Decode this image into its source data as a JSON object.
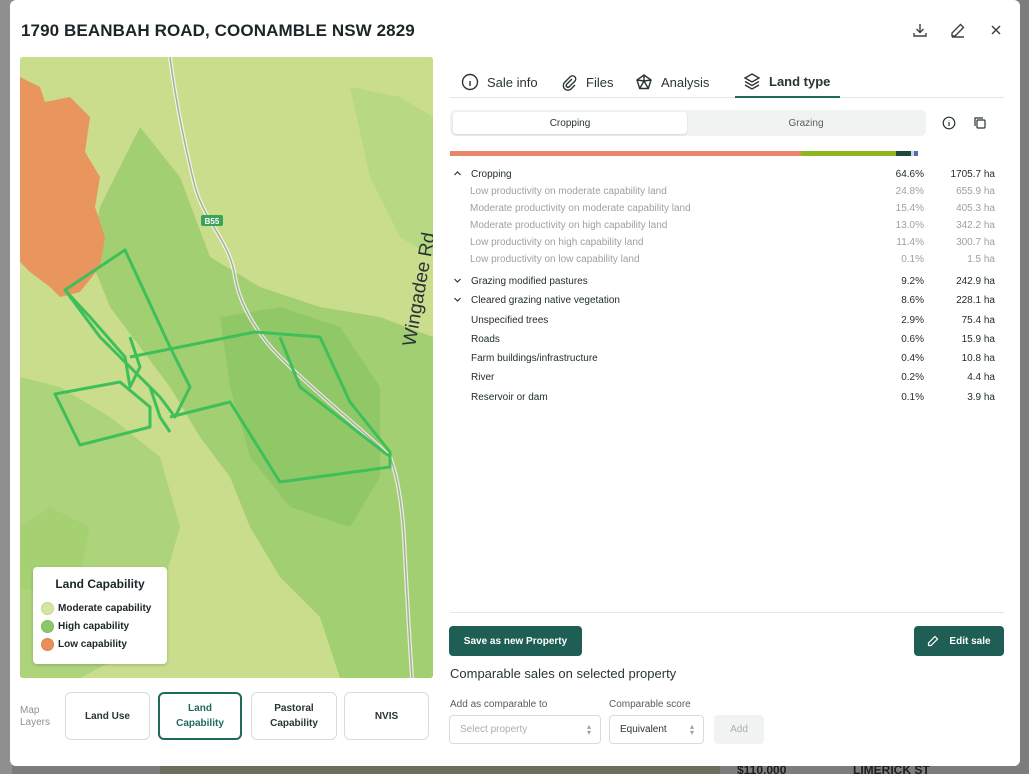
{
  "background": {
    "price": "$110,000",
    "street": "LIMERICK ST"
  },
  "modal": {
    "title": "1790 BEANBAH ROAD, COONAMBLE NSW 2829",
    "icons": [
      "download-icon",
      "edit-icon",
      "close-icon"
    ]
  },
  "map": {
    "road_shield": "B55",
    "road_name": "Wingadee Rd",
    "legend": {
      "title": "Land Capability",
      "items": [
        {
          "label": "Moderate capability",
          "color": "#d6e6a0"
        },
        {
          "label": "High capability",
          "color": "#8cc86a"
        },
        {
          "label": "Low capability",
          "color": "#e88f5a"
        }
      ]
    },
    "layers_label_1": "Map",
    "layers_label_2": "Layers",
    "layer_buttons": [
      {
        "line1": "Land Use",
        "line2": "",
        "active": false
      },
      {
        "line1": "Land",
        "line2": "Capability",
        "active": true
      },
      {
        "line1": "Pastoral",
        "line2": "Capability",
        "active": false
      },
      {
        "line1": "NVIS",
        "line2": "",
        "active": false
      }
    ]
  },
  "tabs": [
    {
      "label": "Sale info",
      "icon": "info-icon"
    },
    {
      "label": "Files",
      "icon": "paperclip-icon"
    },
    {
      "label": "Analysis",
      "icon": "pentagon-icon"
    },
    {
      "label": "Land type",
      "icon": "layers-icon",
      "active": true
    }
  ],
  "segment": {
    "options": [
      "Cropping",
      "Grazing"
    ],
    "selected": "Cropping"
  },
  "bar": [
    {
      "fraction": 0.746,
      "color": "#e8866a"
    },
    {
      "fraction": 0.203,
      "color": "#8fb61e"
    },
    {
      "fraction": 0.032,
      "color": "#1c4a3c"
    },
    {
      "fraction": 0.006,
      "color": "#c7d5e8"
    },
    {
      "fraction": 0.008,
      "color": "#5b6ab0"
    }
  ],
  "land_rows": [
    {
      "type": "main",
      "chev": "^",
      "label": "Cropping",
      "pct": "64.6%",
      "ha": "1705.7 ha"
    },
    {
      "type": "sub",
      "label": "Low productivity on moderate capability land",
      "pct": "24.8%",
      "ha": "655.9 ha"
    },
    {
      "type": "sub",
      "label": "Moderate productivity on moderate capability land",
      "pct": "15.4%",
      "ha": "405.3 ha"
    },
    {
      "type": "sub",
      "label": "Moderate productivity on high capability land",
      "pct": "13.0%",
      "ha": "342.2 ha"
    },
    {
      "type": "sub",
      "label": "Low productivity on high capability land",
      "pct": "11.4%",
      "ha": "300.7 ha"
    },
    {
      "type": "sub",
      "label": "Low productivity on low capability land",
      "pct": "0.1%",
      "ha": "1.5 ha"
    },
    {
      "type": "main",
      "chev": "v",
      "label": "Grazing modified pastures",
      "pct": "9.2%",
      "ha": "242.9 ha"
    },
    {
      "type": "main",
      "chev": "v",
      "label": "Cleared grazing native vegetation",
      "pct": "8.6%",
      "ha": "228.1 ha"
    },
    {
      "type": "main",
      "chev": "",
      "label": "Unspecified trees",
      "pct": "2.9%",
      "ha": "75.4 ha"
    },
    {
      "type": "main",
      "chev": "",
      "label": "Roads",
      "pct": "0.6%",
      "ha": "15.9 ha"
    },
    {
      "type": "main",
      "chev": "",
      "label": "Farm buildings/infrastructure",
      "pct": "0.4%",
      "ha": "10.8 ha"
    },
    {
      "type": "main",
      "chev": "",
      "label": "River",
      "pct": "0.2%",
      "ha": "4.4 ha"
    },
    {
      "type": "main",
      "chev": "",
      "label": "Reservoir or dam",
      "pct": "0.1%",
      "ha": "3.9 ha"
    }
  ],
  "actions": {
    "save_new": "Save as new Property",
    "edit_sale": "Edit sale"
  },
  "comparable": {
    "title": "Comparable sales on selected property",
    "add_label": "Add as comparable to",
    "add_placeholder": "Select property",
    "score_label": "Comparable score",
    "score_value": "Equivalent",
    "add_button": "Add"
  }
}
